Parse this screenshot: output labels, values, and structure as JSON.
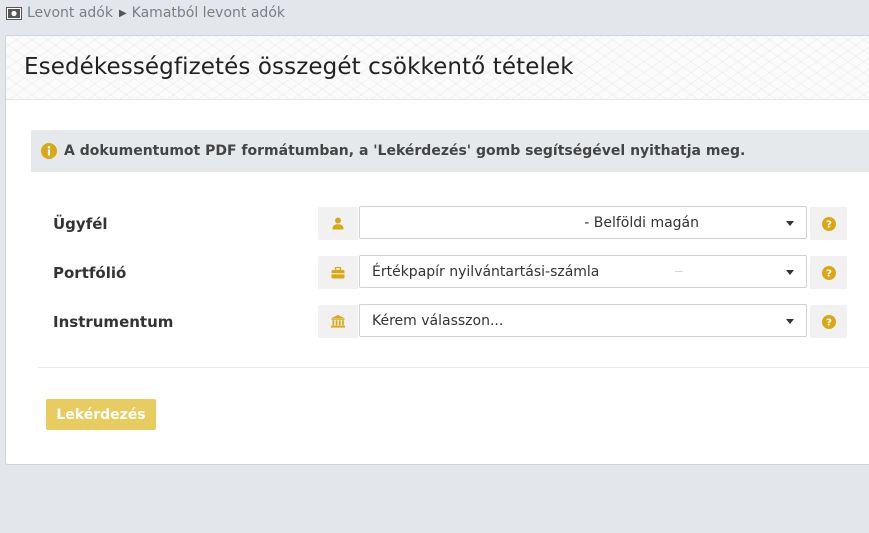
{
  "breadcrumb": {
    "items": [
      "Levont adók",
      "Kamatból levont adók"
    ],
    "icon": "banknote-icon",
    "separator_icon": "caret-right-icon"
  },
  "card": {
    "title": "Esedékességfizetés összegét csökkentő tételek"
  },
  "info": {
    "icon": "info-circle-icon",
    "text": "A dokumentumot PDF formátumban, a 'Lekérdezés' gomb segítségével nyithatja meg."
  },
  "form": {
    "client": {
      "label": "Ügyfél",
      "icon": "user-icon",
      "value": "- Belföldi magán"
    },
    "portfolio": {
      "label": "Portfólió",
      "icon": "briefcase-icon",
      "value": "Értékpapír nyilvántartási-számla"
    },
    "instrument": {
      "label": "Instrumentum",
      "icon": "bank-icon",
      "value": "Kérem válasszon..."
    },
    "help_icon": "question-circle-icon"
  },
  "actions": {
    "query_label": "Lekérdezés"
  },
  "colors": {
    "accent": "#e9cc5f",
    "icon_gold": "#d9a915",
    "background": "#e3e6ea"
  }
}
